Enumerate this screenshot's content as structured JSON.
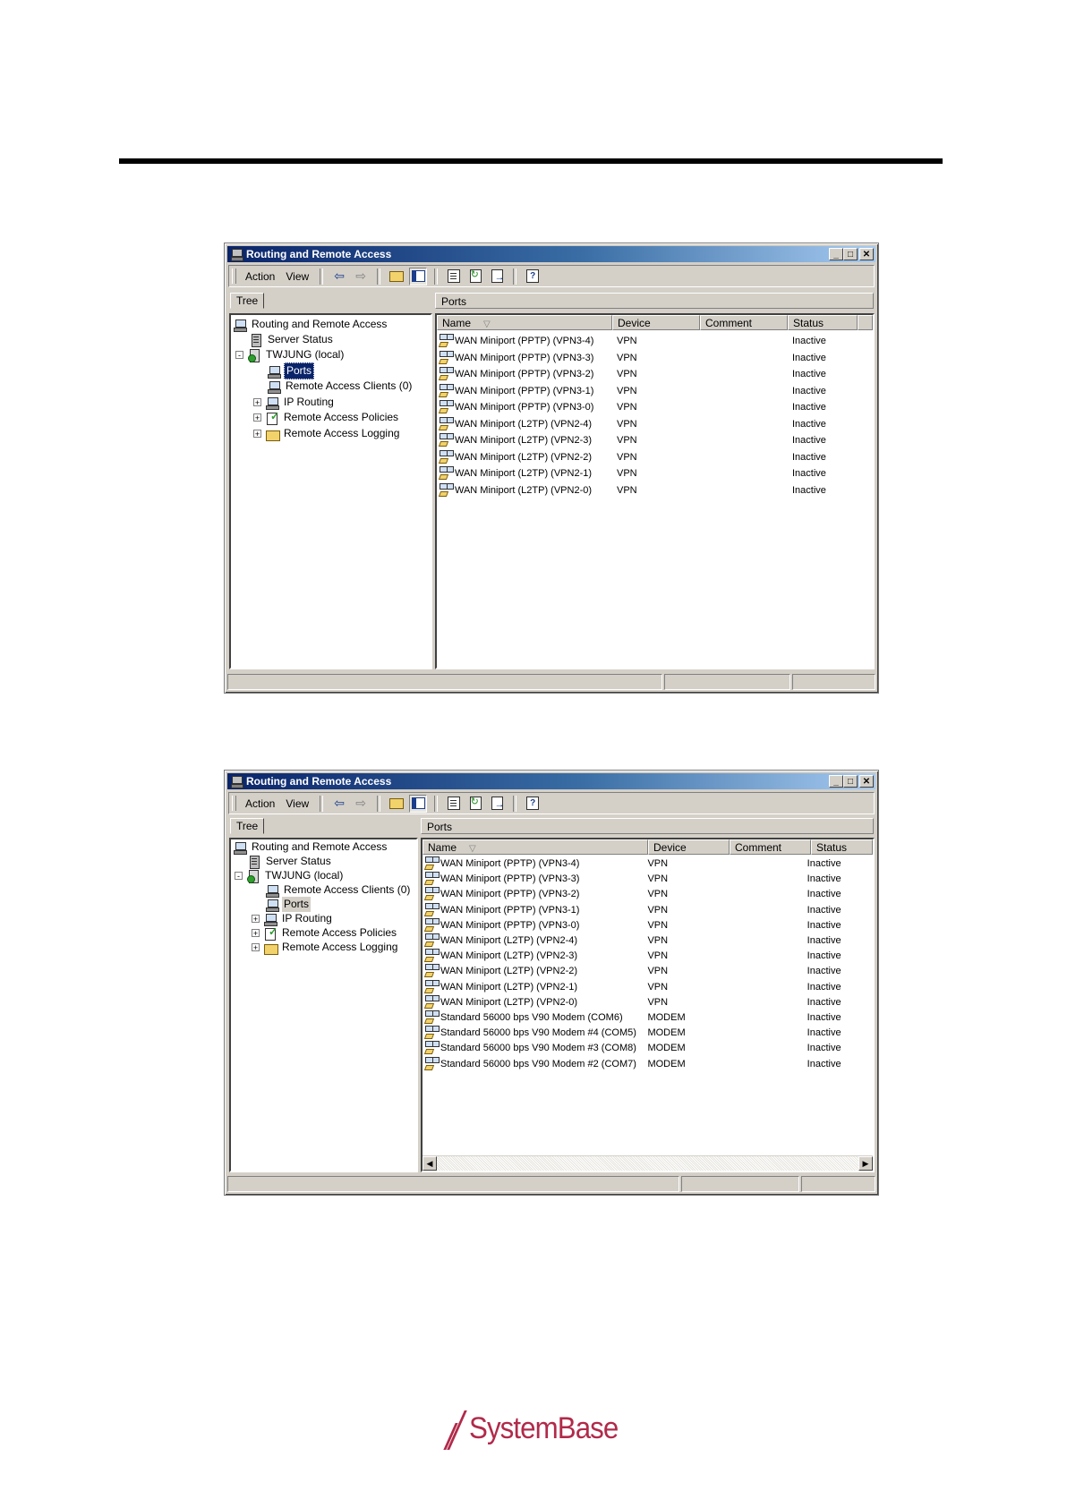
{
  "brand": {
    "name": "SystemBase",
    "color": "#b12a4a"
  },
  "colors": {
    "titlebar_start": "#0a246a",
    "titlebar_end": "#a6caf0",
    "window_face": "#d4d0c8",
    "selection": "#0a246a"
  },
  "windows": [
    {
      "title": "Routing and Remote Access",
      "menu": {
        "action": "Action",
        "view": "View"
      },
      "toolbar_icons": [
        "back-arrow-icon",
        "forward-arrow-icon",
        "up-folder-icon",
        "show-hide-tree-icon",
        "properties-icon",
        "refresh-icon",
        "export-list-icon",
        "help-icon"
      ],
      "tree_tab": "Tree",
      "tree": [
        {
          "label": "Routing and Remote Access",
          "icon": "computer-icon",
          "level": 0,
          "expander": ""
        },
        {
          "label": "Server Status",
          "icon": "server-icon",
          "level": 1,
          "expander": ""
        },
        {
          "label": "TWJUNG (local)",
          "icon": "local-server-icon",
          "level": 1,
          "expander": "-"
        },
        {
          "label": "Ports",
          "icon": "computer-icon",
          "level": 2,
          "expander": "",
          "selected": true
        },
        {
          "label": "Remote Access Clients (0)",
          "icon": "computer-icon",
          "level": 2,
          "expander": ""
        },
        {
          "label": "IP Routing",
          "icon": "computer-icon",
          "level": 2,
          "expander": "+"
        },
        {
          "label": "Remote Access Policies",
          "icon": "policy-icon",
          "level": 2,
          "expander": "+"
        },
        {
          "label": "Remote Access Logging",
          "icon": "folder-icon",
          "level": 2,
          "expander": "+"
        }
      ],
      "pane_title": "Ports",
      "columns": {
        "name": "Name",
        "device": "Device",
        "comment": "Comment",
        "status": "Status"
      },
      "rows": [
        {
          "name": "WAN Miniport (PPTP) (VPN3-4)",
          "device": "VPN",
          "comment": "",
          "status": "Inactive"
        },
        {
          "name": "WAN Miniport (PPTP) (VPN3-3)",
          "device": "VPN",
          "comment": "",
          "status": "Inactive"
        },
        {
          "name": "WAN Miniport (PPTP) (VPN3-2)",
          "device": "VPN",
          "comment": "",
          "status": "Inactive"
        },
        {
          "name": "WAN Miniport (PPTP) (VPN3-1)",
          "device": "VPN",
          "comment": "",
          "status": "Inactive"
        },
        {
          "name": "WAN Miniport (PPTP) (VPN3-0)",
          "device": "VPN",
          "comment": "",
          "status": "Inactive"
        },
        {
          "name": "WAN Miniport (L2TP) (VPN2-4)",
          "device": "VPN",
          "comment": "",
          "status": "Inactive"
        },
        {
          "name": "WAN Miniport (L2TP) (VPN2-3)",
          "device": "VPN",
          "comment": "",
          "status": "Inactive"
        },
        {
          "name": "WAN Miniport (L2TP) (VPN2-2)",
          "device": "VPN",
          "comment": "",
          "status": "Inactive"
        },
        {
          "name": "WAN Miniport (L2TP) (VPN2-1)",
          "device": "VPN",
          "comment": "",
          "status": "Inactive"
        },
        {
          "name": "WAN Miniport (L2TP) (VPN2-0)",
          "device": "VPN",
          "comment": "",
          "status": "Inactive"
        }
      ]
    },
    {
      "title": "Routing and Remote Access",
      "menu": {
        "action": "Action",
        "view": "View"
      },
      "toolbar_icons": [
        "back-arrow-icon",
        "forward-arrow-icon",
        "up-folder-icon",
        "show-hide-tree-icon",
        "properties-icon",
        "refresh-icon",
        "export-list-icon",
        "help-icon"
      ],
      "tree_tab": "Tree",
      "tree": [
        {
          "label": "Routing and Remote Access",
          "icon": "computer-icon",
          "level": 0,
          "expander": ""
        },
        {
          "label": "Server Status",
          "icon": "server-icon",
          "level": 1,
          "expander": ""
        },
        {
          "label": "TWJUNG (local)",
          "icon": "local-server-icon",
          "level": 1,
          "expander": "-"
        },
        {
          "label": "Remote Access Clients (0)",
          "icon": "computer-icon",
          "level": 2,
          "expander": ""
        },
        {
          "label": "Ports",
          "icon": "computer-icon",
          "level": 2,
          "expander": "",
          "selected": true
        },
        {
          "label": "IP Routing",
          "icon": "computer-icon",
          "level": 2,
          "expander": "+"
        },
        {
          "label": "Remote Access Policies",
          "icon": "policy-icon",
          "level": 2,
          "expander": "+"
        },
        {
          "label": "Remote Access Logging",
          "icon": "folder-icon",
          "level": 2,
          "expander": "+"
        }
      ],
      "pane_title": "Ports",
      "columns": {
        "name": "Name",
        "device": "Device",
        "comment": "Comment",
        "status": "Status"
      },
      "rows": [
        {
          "name": "WAN Miniport (PPTP) (VPN3-4)",
          "device": "VPN",
          "comment": "",
          "status": "Inactive"
        },
        {
          "name": "WAN Miniport (PPTP) (VPN3-3)",
          "device": "VPN",
          "comment": "",
          "status": "Inactive"
        },
        {
          "name": "WAN Miniport (PPTP) (VPN3-2)",
          "device": "VPN",
          "comment": "",
          "status": "Inactive"
        },
        {
          "name": "WAN Miniport (PPTP) (VPN3-1)",
          "device": "VPN",
          "comment": "",
          "status": "Inactive"
        },
        {
          "name": "WAN Miniport (PPTP) (VPN3-0)",
          "device": "VPN",
          "comment": "",
          "status": "Inactive"
        },
        {
          "name": "WAN Miniport (L2TP) (VPN2-4)",
          "device": "VPN",
          "comment": "",
          "status": "Inactive"
        },
        {
          "name": "WAN Miniport (L2TP) (VPN2-3)",
          "device": "VPN",
          "comment": "",
          "status": "Inactive"
        },
        {
          "name": "WAN Miniport (L2TP) (VPN2-2)",
          "device": "VPN",
          "comment": "",
          "status": "Inactive"
        },
        {
          "name": "WAN Miniport (L2TP) (VPN2-1)",
          "device": "VPN",
          "comment": "",
          "status": "Inactive"
        },
        {
          "name": "WAN Miniport (L2TP) (VPN2-0)",
          "device": "VPN",
          "comment": "",
          "status": "Inactive"
        },
        {
          "name": "Standard 56000 bps V90 Modem (COM6)",
          "device": "MODEM",
          "comment": "",
          "status": "Inactive"
        },
        {
          "name": "Standard 56000 bps V90 Modem #4 (COM5)",
          "device": "MODEM",
          "comment": "",
          "status": "Inactive"
        },
        {
          "name": "Standard 56000 bps V90 Modem #3 (COM8)",
          "device": "MODEM",
          "comment": "",
          "status": "Inactive"
        },
        {
          "name": "Standard 56000 bps V90 Modem #2 (COM7)",
          "device": "MODEM",
          "comment": "",
          "status": "Inactive"
        }
      ]
    }
  ]
}
